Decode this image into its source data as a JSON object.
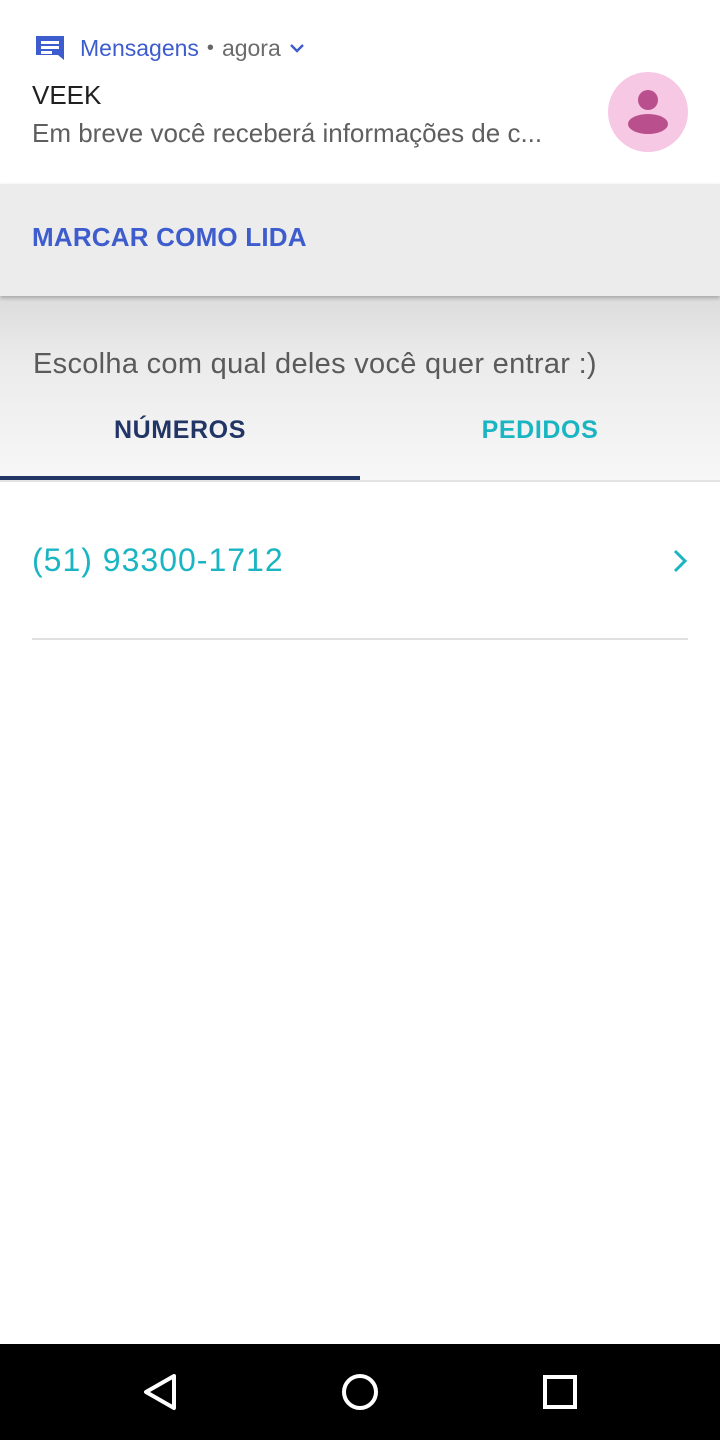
{
  "notification": {
    "app_icon": "messages-app-icon",
    "app_name": "Mensagens",
    "separator": "•",
    "time": "agora",
    "expand_icon": "chevron-down-icon",
    "sender": "VEEK",
    "preview": "Em breve você receberá informações de c...",
    "avatar_icon": "person-icon",
    "action_label": "MARCAR COMO LIDA",
    "colors": {
      "accent": "#3d5ccd",
      "avatar_bg": "#f6c8e4",
      "avatar_fg": "#b94f8c"
    }
  },
  "app": {
    "subtitle": "Escolha com qual deles você quer entrar :)",
    "tabs": [
      {
        "label": "NÚMEROS",
        "active": true
      },
      {
        "label": "PEDIDOS",
        "active": false
      }
    ],
    "list": [
      {
        "phone": "(51) 93300-1712",
        "icon": "chevron-right-icon"
      }
    ],
    "colors": {
      "primary": "#223666",
      "teal": "#1ab5c2"
    }
  },
  "navbar": {
    "back_icon": "back-triangle-icon",
    "home_icon": "home-circle-icon",
    "recents_icon": "recents-square-icon"
  }
}
